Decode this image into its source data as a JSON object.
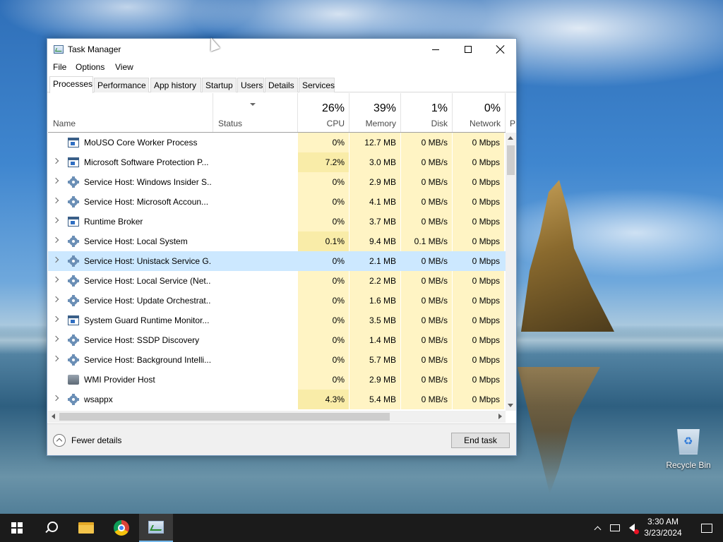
{
  "window": {
    "title": "Task Manager",
    "controls": {
      "minimize": "minimize",
      "maximize": "maximize",
      "close": "close"
    }
  },
  "menu": [
    "File",
    "Options",
    "View"
  ],
  "tabs": [
    {
      "label": "Processes",
      "active": true
    },
    {
      "label": "Performance",
      "active": false
    },
    {
      "label": "App history",
      "active": false
    },
    {
      "label": "Startup",
      "active": false
    },
    {
      "label": "Users",
      "active": false
    },
    {
      "label": "Details",
      "active": false
    },
    {
      "label": "Services",
      "active": false
    }
  ],
  "columns": {
    "name": {
      "label": "Name"
    },
    "status": {
      "label": "Status"
    },
    "cpu": {
      "label": "CPU",
      "percent": "26%"
    },
    "memory": {
      "label": "Memory",
      "percent": "39%"
    },
    "disk": {
      "label": "Disk",
      "percent": "1%"
    },
    "network": {
      "label": "Network",
      "percent": "0%"
    },
    "overflow": {
      "label": "P"
    }
  },
  "processes": [
    {
      "name": "MoUSO Core Worker Process",
      "icon": "window-icon",
      "expandable": false,
      "cpu": "0%",
      "memory": "12.7 MB",
      "disk": "0 MB/s",
      "network": "0 Mbps"
    },
    {
      "name": "Microsoft Software Protection P...",
      "icon": "window-icon",
      "expandable": true,
      "cpu": "7.2%",
      "memory": "3.0 MB",
      "disk": "0 MB/s",
      "network": "0 Mbps"
    },
    {
      "name": "Service Host: Windows Insider S...",
      "icon": "gear-icon",
      "expandable": true,
      "cpu": "0%",
      "memory": "2.9 MB",
      "disk": "0 MB/s",
      "network": "0 Mbps"
    },
    {
      "name": "Service Host: Microsoft Accoun...",
      "icon": "gear-icon",
      "expandable": true,
      "cpu": "0%",
      "memory": "4.1 MB",
      "disk": "0 MB/s",
      "network": "0 Mbps"
    },
    {
      "name": "Runtime Broker",
      "icon": "window-icon",
      "expandable": true,
      "cpu": "0%",
      "memory": "3.7 MB",
      "disk": "0 MB/s",
      "network": "0 Mbps"
    },
    {
      "name": "Service Host: Local System",
      "icon": "gear-icon",
      "expandable": true,
      "cpu": "0.1%",
      "memory": "9.4 MB",
      "disk": "0.1 MB/s",
      "network": "0 Mbps"
    },
    {
      "name": "Service Host: Unistack Service G...",
      "icon": "gear-icon",
      "expandable": true,
      "selected": true,
      "cpu": "0%",
      "memory": "2.1 MB",
      "disk": "0 MB/s",
      "network": "0 Mbps"
    },
    {
      "name": "Service Host: Local Service (Net...",
      "icon": "gear-icon",
      "expandable": true,
      "cpu": "0%",
      "memory": "2.2 MB",
      "disk": "0 MB/s",
      "network": "0 Mbps"
    },
    {
      "name": "Service Host: Update Orchestrat...",
      "icon": "gear-icon",
      "expandable": true,
      "cpu": "0%",
      "memory": "1.6 MB",
      "disk": "0 MB/s",
      "network": "0 Mbps"
    },
    {
      "name": "System Guard Runtime Monitor...",
      "icon": "window-icon",
      "expandable": true,
      "cpu": "0%",
      "memory": "3.5 MB",
      "disk": "0 MB/s",
      "network": "0 Mbps"
    },
    {
      "name": "Service Host: SSDP Discovery",
      "icon": "gear-icon",
      "expandable": true,
      "cpu": "0%",
      "memory": "1.4 MB",
      "disk": "0 MB/s",
      "network": "0 Mbps"
    },
    {
      "name": "Service Host: Background Intelli...",
      "icon": "gear-icon",
      "expandable": true,
      "cpu": "0%",
      "memory": "5.7 MB",
      "disk": "0 MB/s",
      "network": "0 Mbps"
    },
    {
      "name": "WMI Provider Host",
      "icon": "wmi-icon",
      "expandable": false,
      "cpu": "0%",
      "memory": "2.9 MB",
      "disk": "0 MB/s",
      "network": "0 Mbps"
    },
    {
      "name": "wsappx",
      "icon": "gear-icon",
      "expandable": true,
      "cpu": "4.3%",
      "memory": "5.4 MB",
      "disk": "0 MB/s",
      "network": "0 Mbps"
    }
  ],
  "footer": {
    "fewer_details": "Fewer details",
    "end_task": "End task"
  },
  "desktop": {
    "recycle_bin": "Recycle Bin"
  },
  "taskbar": {
    "time": "3:30 AM",
    "date": "3/23/2024",
    "apps": [
      "start-icon",
      "search-icon",
      "file-explorer-icon",
      "chrome-icon",
      "task-manager-icon"
    ]
  },
  "colors": {
    "selected_row": "#cce8ff",
    "heat_light": "#fff4c4",
    "heat_dark": "#f9eca8",
    "taskbar": "#1b1b1b"
  }
}
